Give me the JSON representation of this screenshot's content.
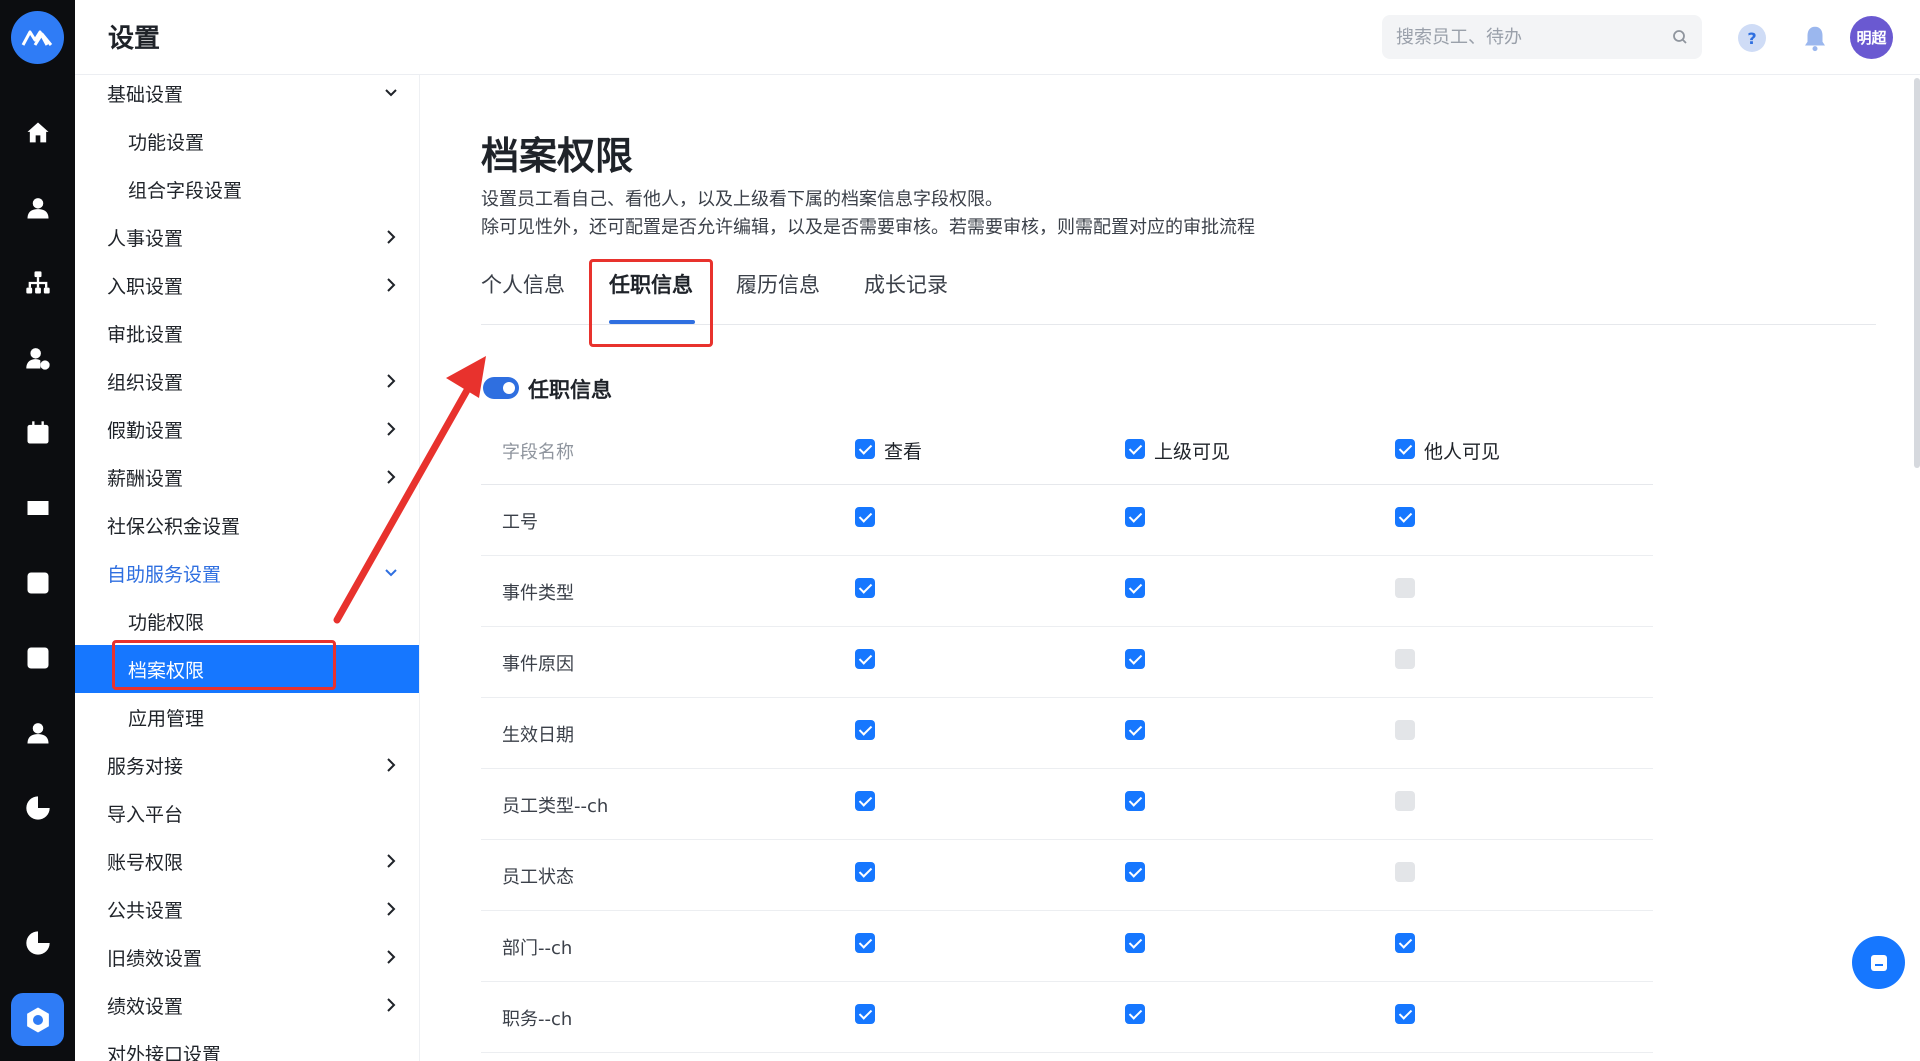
{
  "header": {
    "title": "设置",
    "search_placeholder": "搜索员工、待办",
    "help_label": "?",
    "avatar_text": "明超"
  },
  "rail": {
    "icons": [
      "home-icon",
      "user-icon",
      "org-tree-icon",
      "user-add-icon",
      "calendar-icon",
      "yen-icon",
      "chart-box-icon",
      "chart-box-icon",
      "person-icon",
      "pie-chart-icon",
      "pie-chart-icon",
      "settings-icon"
    ]
  },
  "sidebar": {
    "items": [
      {
        "label": "基础设置",
        "chevron": "down"
      },
      {
        "label": "功能设置",
        "sub": true
      },
      {
        "label": "组合字段设置",
        "sub": true
      },
      {
        "label": "人事设置",
        "chevron": "right"
      },
      {
        "label": "入职设置",
        "chevron": "right"
      },
      {
        "label": "审批设置"
      },
      {
        "label": "组织设置",
        "chevron": "right"
      },
      {
        "label": "假勤设置",
        "chevron": "right"
      },
      {
        "label": "薪酬设置",
        "chevron": "right"
      },
      {
        "label": "社保公积金设置"
      },
      {
        "label": "自助服务设置",
        "chevron": "down",
        "active_parent": true
      },
      {
        "label": "功能权限",
        "sub": true
      },
      {
        "label": "档案权限",
        "sub": true,
        "selected": true
      },
      {
        "label": "应用管理",
        "sub": true
      },
      {
        "label": "服务对接",
        "chevron": "right"
      },
      {
        "label": "导入平台"
      },
      {
        "label": "账号权限",
        "chevron": "right"
      },
      {
        "label": "公共设置",
        "chevron": "right"
      },
      {
        "label": "旧绩效设置",
        "chevron": "right"
      },
      {
        "label": "绩效设置",
        "chevron": "right"
      },
      {
        "label": "对外接口设置"
      }
    ]
  },
  "main": {
    "title": "档案权限",
    "desc_line1": "设置员工看自己、看他人，以及上级看下属的档案信息字段权限。",
    "desc_line2": "除可见性外，还可配置是否允许编辑，以及是否需要审核。若需要审核，则需配置对应的审批流程",
    "tabs": [
      "个人信息",
      "任职信息",
      "履历信息",
      "成长记录"
    ],
    "active_tab": 1,
    "section_title": "任职信息",
    "section_enabled": true,
    "table": {
      "header": {
        "name": "字段名称",
        "col1": "查看",
        "col2": "上级可见",
        "col3": "他人可见"
      },
      "header_checks": [
        true,
        true,
        true
      ],
      "rows": [
        {
          "name": "工号",
          "checks": [
            true,
            true,
            true
          ]
        },
        {
          "name": "事件类型",
          "checks": [
            true,
            true,
            false
          ]
        },
        {
          "name": "事件原因",
          "checks": [
            true,
            true,
            false
          ]
        },
        {
          "name": "生效日期",
          "checks": [
            true,
            true,
            false
          ]
        },
        {
          "name": "员工类型--ch",
          "checks": [
            true,
            true,
            false
          ]
        },
        {
          "name": "员工状态",
          "checks": [
            true,
            true,
            false
          ]
        },
        {
          "name": "部门--ch",
          "checks": [
            true,
            true,
            true
          ]
        },
        {
          "name": "职务--ch",
          "checks": [
            true,
            true,
            true
          ]
        }
      ]
    }
  },
  "colors": {
    "accent": "#1677ff",
    "annotation": "#e8322d",
    "rail": "#0c0d10"
  }
}
